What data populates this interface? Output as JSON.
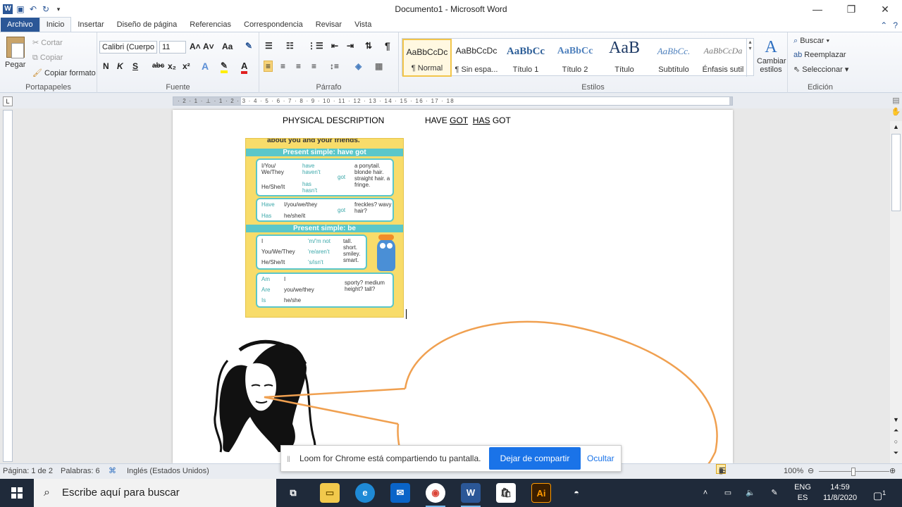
{
  "window": {
    "title": "Documento1 - Microsoft Word"
  },
  "tabs": [
    "Archivo",
    "Inicio",
    "Insertar",
    "Diseño de página",
    "Referencias",
    "Correspondencia",
    "Revisar",
    "Vista"
  ],
  "clipboard": {
    "paste": "Pegar",
    "cut": "Cortar",
    "copy": "Copiar",
    "format_painter": "Copiar formato",
    "group": "Portapapeles"
  },
  "font": {
    "name": "Calibri (Cuerpo",
    "size": "11",
    "bold": "N",
    "italic": "K",
    "underline": "S",
    "strike": "abc",
    "subscript": "x₂",
    "superscript": "x²",
    "case": "Aa",
    "group": "Fuente"
  },
  "paragraph": {
    "pilcrow": "¶",
    "group": "Párrafo"
  },
  "styles": {
    "group": "Estilos",
    "items": [
      {
        "sample": "AaBbCcDc",
        "name": "¶ Normal"
      },
      {
        "sample": "AaBbCcDc",
        "name": "¶ Sin espa..."
      },
      {
        "sample": "AaBbCc",
        "name": "Título 1"
      },
      {
        "sample": "AaBbCc",
        "name": "Título 2"
      },
      {
        "sample": "AaB",
        "name": "Título"
      },
      {
        "sample": "AaBbCc.",
        "name": "Subtítulo"
      },
      {
        "sample": "AaBbCcDa",
        "name": "Énfasis sutil"
      }
    ],
    "change": "Cambiar estilos"
  },
  "editing": {
    "find": "Buscar",
    "replace": "Reemplazar",
    "select": "Seleccionar",
    "group": "Edición"
  },
  "ruler": {
    "marks": "· 2 · 1 · ⊥ · 1 · 2 · 3 · 4 · 5 · 6 · 7 · 8 · 9 · 10 · 11 · 12 · 13 · 14 · 15 · 16 · 17 · 18"
  },
  "document": {
    "heading_left": "PHYSICAL DESCRIPTION",
    "heading_right_prefix": "HAVE ",
    "heading_right_got1": "GOT",
    "heading_right_has": "HAS",
    "heading_right_got2": " GOT",
    "grammar": {
      "intro": "about you and your friends.",
      "title1": "Present simple: have got",
      "rows1": [
        {
          "subj": "I/You/ We/They",
          "verb": "have haven't"
        },
        {
          "subj": "He/She/It",
          "verb": "has hasn't"
        }
      ],
      "got": "got",
      "objects1": "a ponytail. blonde hair. straight hair. a fringe.",
      "q_have": "Have",
      "q_has": "Has",
      "q_subj1": "I/you/we/they",
      "q_subj2": "he/she/it",
      "q_obj": "freckles? wavy hair?",
      "title2": "Present simple: be",
      "be_rows": [
        {
          "subj": "I",
          "verb": "'m/'m not"
        },
        {
          "subj": "You/We/They",
          "verb": "'re/aren't"
        },
        {
          "subj": "He/She/It",
          "verb": "'s/isn't"
        }
      ],
      "be_adj": "tall. short. smiley. smart.",
      "q_am": "Am",
      "q_are": "Are",
      "q_is": "Is",
      "q2_subj": [
        "I",
        "you/we/they",
        "he/she"
      ],
      "q2_obj": "sporty? medium height? tall?"
    }
  },
  "status": {
    "page": "Página: 1 de 2",
    "words": "Palabras: 6",
    "language": "Inglés (Estados Unidos)",
    "zoom": "100%"
  },
  "loom": {
    "message": "Loom for Chrome está compartiendo tu pantalla.",
    "stop": "Dejar de compartir",
    "hide": "Ocultar"
  },
  "taskbar": {
    "search_placeholder": "Escribe aquí para buscar",
    "lang": "ENG",
    "lang2": "ES",
    "time": "14:59",
    "date": "11/8/2020",
    "notif_count": "1"
  }
}
